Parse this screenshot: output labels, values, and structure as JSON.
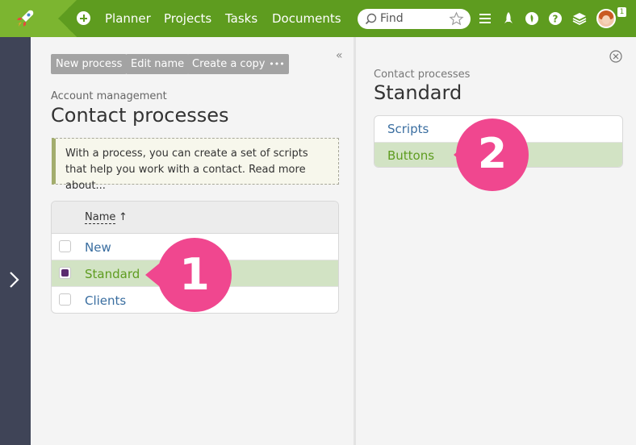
{
  "topbar": {
    "nav": [
      "Planner",
      "Projects",
      "Tasks",
      "Documents"
    ],
    "search_placeholder": "Find",
    "notification_count": "1",
    "accent": "#5e9c1f"
  },
  "left_panel": {
    "toolbar": {
      "new_process": "New process",
      "edit_name": "Edit name",
      "create_copy": "Create a copy",
      "more": "•••"
    },
    "collapse": "«",
    "breadcrumb": "Account management",
    "title": "Contact processes",
    "info": "With a process, you can create a set of scripts that help you work with a contact. Read more about...",
    "table": {
      "header": "Name",
      "sort": "↑",
      "rows": [
        {
          "name": "New",
          "checked": false
        },
        {
          "name": "Standard",
          "checked": true
        },
        {
          "name": "Clients",
          "checked": false
        }
      ]
    }
  },
  "right_panel": {
    "breadcrumb": "Contact processes",
    "title": "Standard",
    "items": [
      "Scripts",
      "Buttons"
    ],
    "selected_item": "Buttons"
  },
  "callouts": [
    "1",
    "2"
  ],
  "callout_color": "#f0478f"
}
